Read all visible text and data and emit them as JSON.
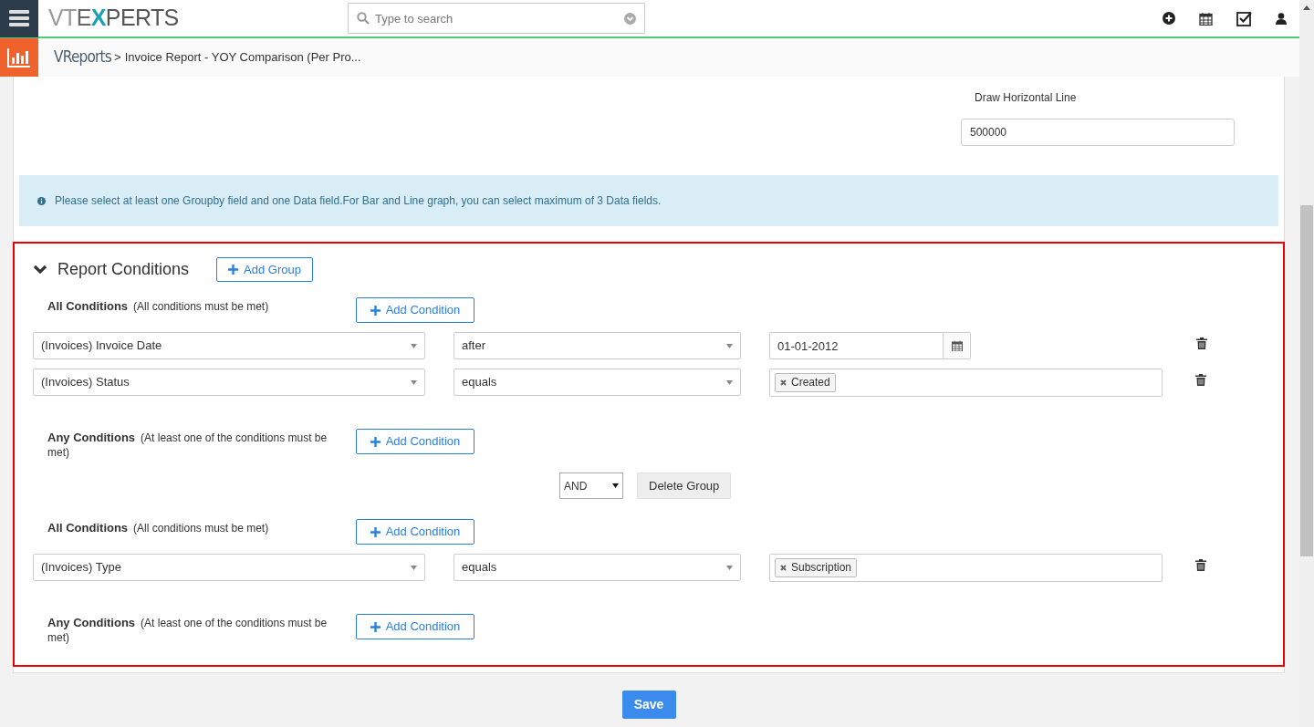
{
  "header": {
    "logo": "VTEXPERTS",
    "search": {
      "placeholder": "Type to search"
    }
  },
  "breadcrumb": {
    "module": "VReports",
    "separator": ">",
    "page": "Invoice Report - YOY Comparison (Per Pro..."
  },
  "horizontal_line": {
    "label": "Draw Horizontal Line",
    "value": "500000"
  },
  "info": "Please select at least one Groupby field and one Data field.For Bar and Line graph, you can select maximum of 3 Data fields.",
  "conditions": {
    "title": "Report Conditions",
    "expanded": true,
    "add_group": "Add Group",
    "groups": [
      {
        "all": {
          "title": "All Conditions",
          "note": "(All conditions must be met)",
          "button": "Add Condition",
          "rows": [
            {
              "field": "(Invoices) Invoice Date",
              "operator": "after",
              "kind": "date",
              "value": "01-01-2012"
            },
            {
              "field": "(Invoices) Status",
              "operator": "equals",
              "kind": "tags",
              "tags": [
                "Created"
              ]
            }
          ]
        },
        "any": {
          "title": "Any Conditions",
          "note": "(At least one of the conditions must be met)",
          "button": "Add Condition"
        },
        "joiner": {
          "operator": "AND",
          "delete": "Delete Group"
        }
      },
      {
        "all": {
          "title": "All Conditions",
          "note": "(All conditions must be met)",
          "button": "Add Condition",
          "rows": [
            {
              "field": "(Invoices) Type",
              "operator": "equals",
              "kind": "tags",
              "tags": [
                "Subscription"
              ]
            }
          ]
        },
        "any": {
          "title": "Any Conditions",
          "note": "(At least one of the conditions must be met)",
          "button": "Add Condition"
        }
      }
    ]
  },
  "save": "Save"
}
